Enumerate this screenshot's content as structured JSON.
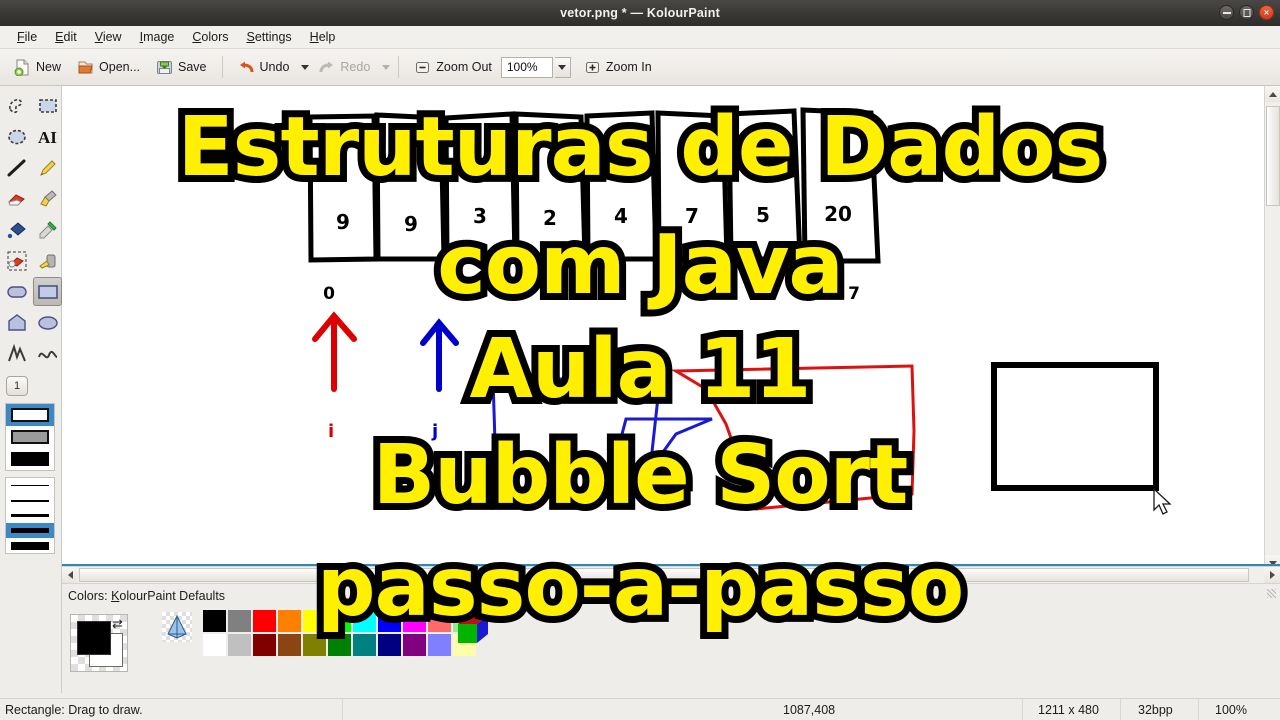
{
  "window": {
    "title": "vetor.png * — KolourPaint",
    "buttons": {
      "minimize": "–",
      "maximize": "□",
      "close": "x"
    }
  },
  "menubar": {
    "items": [
      {
        "label": "File",
        "accel": "F"
      },
      {
        "label": "Edit",
        "accel": "E"
      },
      {
        "label": "View",
        "accel": "V"
      },
      {
        "label": "Image",
        "accel": "I"
      },
      {
        "label": "Colors",
        "accel": "C"
      },
      {
        "label": "Settings",
        "accel": "S"
      },
      {
        "label": "Help",
        "accel": "H"
      }
    ]
  },
  "toolbar": {
    "new_label": "New",
    "open_label": "Open...",
    "save_label": "Save",
    "undo_label": "Undo",
    "redo_label": "Redo",
    "zoom_out_label": "Zoom Out",
    "zoom_in_label": "Zoom In",
    "zoom_value": "100%"
  },
  "tooldock": {
    "tools": [
      {
        "name": "free-form-select",
        "label": "Free-Form Select"
      },
      {
        "name": "rectangle-select",
        "label": "Rectangle Select"
      },
      {
        "name": "elliptical-select",
        "label": "Elliptical Select"
      },
      {
        "name": "text",
        "label": "Text"
      },
      {
        "name": "line",
        "label": "Line"
      },
      {
        "name": "pen",
        "label": "Pen"
      },
      {
        "name": "eraser",
        "label": "Eraser"
      },
      {
        "name": "brush",
        "label": "Brush"
      },
      {
        "name": "flood-fill",
        "label": "Flood Fill"
      },
      {
        "name": "color-picker",
        "label": "Color Picker"
      },
      {
        "name": "color-washer",
        "label": "Color Washer"
      },
      {
        "name": "spraycan",
        "label": "Spraycan"
      },
      {
        "name": "rounded-rectangle",
        "label": "Rounded Rectangle"
      },
      {
        "name": "rectangle",
        "label": "Rectangle"
      },
      {
        "name": "polygon",
        "label": "Polygon"
      },
      {
        "name": "ellipse",
        "label": "Ellipse"
      },
      {
        "name": "polyline",
        "label": "Polyline"
      },
      {
        "name": "curve",
        "label": "Curve"
      }
    ],
    "selected_tool": "rectangle",
    "brush_number": "1",
    "fill_styles": [
      "outline",
      "outline-with-fill",
      "filled"
    ],
    "fill_selected_index": 0,
    "line_widths": [
      1,
      2,
      3,
      5,
      8
    ],
    "line_width_selected_index": 3
  },
  "colordock": {
    "label_prefix": "Colors: ",
    "label_name": "KolourPaint Defaults",
    "foreground": "#000000",
    "background": "#ffffff",
    "palette_row1": [
      "#000000",
      "#808080",
      "#ff0000",
      "#ff8000",
      "#ffff00",
      "#00ff00",
      "#00ffff",
      "#0000ff",
      "#ff00ff",
      "#ff6a6a",
      "#90ee90"
    ],
    "palette_row2": [
      "#ffffff",
      "#c0c0c0",
      "#800000",
      "#8b4513",
      "#808000",
      "#008000",
      "#008080",
      "#000080",
      "#800080",
      "#8080ff",
      "#ffffaa"
    ]
  },
  "statusbar": {
    "message": "Rectangle: Drag to draw.",
    "position": "1087,408",
    "dimensions": "1211 x 480",
    "depth": "32bpp",
    "zoom": "100%"
  },
  "canvas": {
    "array_cells": [
      "9",
      "9",
      "3",
      "2",
      "4",
      "7",
      "5",
      "20"
    ],
    "index_start": "0",
    "index_end": "7",
    "pointer_i": "i",
    "pointer_j": "j",
    "pointer_i_color": "#dd0000",
    "pointer_j_color": "#0000cc",
    "shapes": [
      {
        "name": "blue-polygon",
        "color": "#1a1ad0"
      },
      {
        "name": "red-polygon",
        "color": "#e01010"
      },
      {
        "name": "black-rectangle",
        "color": "#000000"
      }
    ]
  },
  "overlay": {
    "lines": [
      "Estruturas de Dados",
      "com Java",
      "Aula 11",
      "Bubble Sort",
      "passo-a-passo"
    ],
    "fill_color": "#ffef00",
    "stroke_color": "#000000"
  }
}
